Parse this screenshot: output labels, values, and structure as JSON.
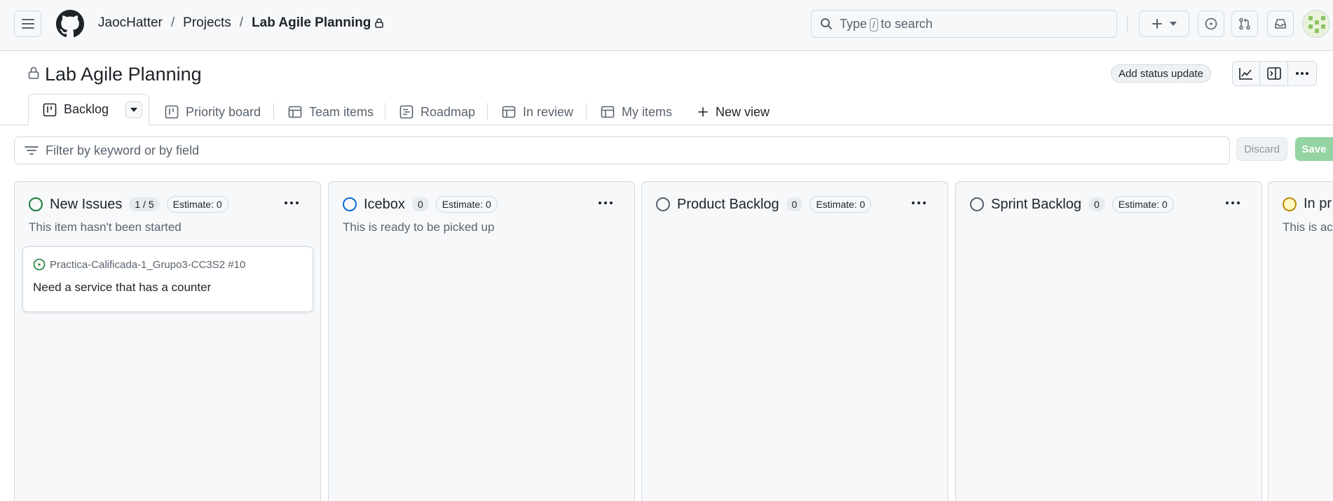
{
  "breadcrumb": {
    "owner": "JaocHatter",
    "projects": "Projects",
    "current": "Lab Agile Planning"
  },
  "search": {
    "prefix": "Type",
    "key": "/",
    "suffix": "to search"
  },
  "project": {
    "title": "Lab Agile Planning",
    "status_update_label": "Add status update"
  },
  "tabs": [
    {
      "label": "Backlog"
    },
    {
      "label": "Priority board"
    },
    {
      "label": "Team items"
    },
    {
      "label": "Roadmap"
    },
    {
      "label": "In review"
    },
    {
      "label": "My items"
    }
  ],
  "new_view_label": "New view",
  "filter": {
    "placeholder": "Filter by keyword or by field",
    "discard_label": "Discard",
    "save_label": "Save"
  },
  "columns": [
    {
      "name": "New Issues",
      "count": "1 / 5",
      "estimate": "Estimate: 0",
      "description": "This item hasn't been started",
      "status_color": "#1a7f37",
      "cards": [
        {
          "repo": "Practica-Calificada-1_Grupo3-CC3S2 #10",
          "title": "Need a service that has a counter"
        }
      ]
    },
    {
      "name": "Icebox",
      "count": "0",
      "estimate": "Estimate: 0",
      "description": "This is ready to be picked up",
      "status_color": "#0969da"
    },
    {
      "name": "Product Backlog",
      "count": "0",
      "estimate": "Estimate: 0",
      "description": "",
      "status_color": "#59636e"
    },
    {
      "name": "Sprint Backlog",
      "count": "0",
      "estimate": "Estimate: 0",
      "description": "",
      "status_color": "#59636e"
    },
    {
      "name": "In pr",
      "description": "This is act",
      "status_color": "#bf8700"
    }
  ],
  "icons": [
    "menu-icon",
    "github-logo-icon",
    "lock-icon",
    "search-icon",
    "plus-icon",
    "triangle-down-icon",
    "issue-opened-icon",
    "git-pull-request-icon",
    "inbox-icon",
    "graph-icon",
    "sidebar-expand-icon",
    "kebab-horizontal-icon",
    "project-board-icon",
    "table-icon",
    "roadmap-icon",
    "filter-icon"
  ]
}
